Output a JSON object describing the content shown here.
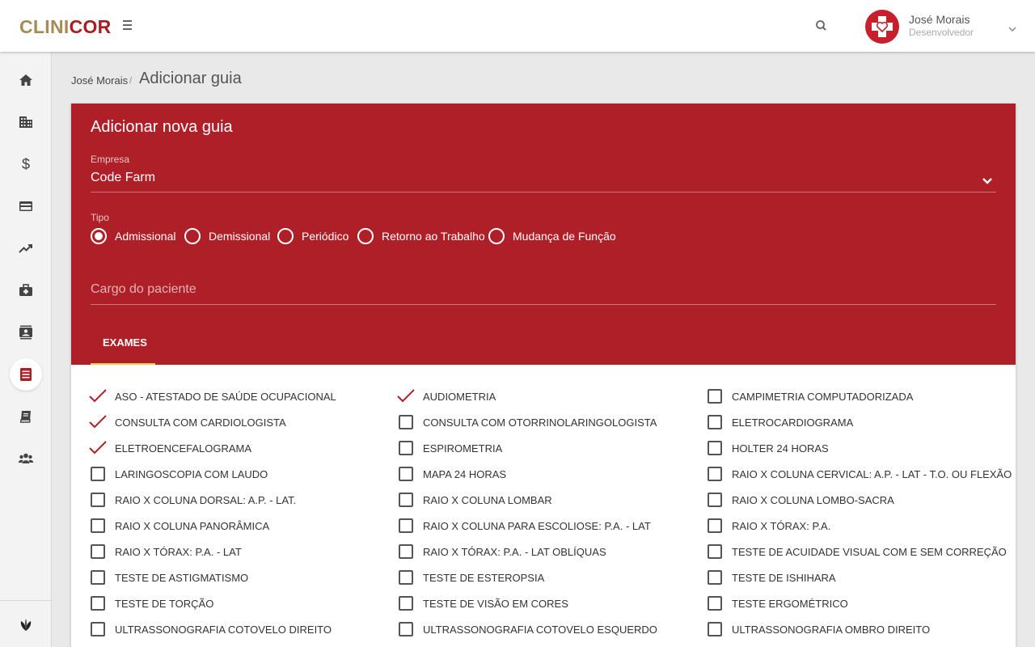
{
  "app": {
    "logo_part1": "CLINI",
    "logo_part2": "COR",
    "brand_red": "#ae1f27",
    "brand_gold": "#a88a57"
  },
  "user": {
    "name": "José Morais",
    "role": "Desenvolvedor"
  },
  "sidebar": {
    "items": [
      {
        "icon": "home-icon"
      },
      {
        "icon": "building-icon"
      },
      {
        "icon": "dollar-icon"
      },
      {
        "icon": "credit-card-icon"
      },
      {
        "icon": "trending-up-icon"
      },
      {
        "icon": "medical-kit-icon"
      },
      {
        "icon": "contacts-icon"
      },
      {
        "icon": "list-icon",
        "active": true
      },
      {
        "icon": "book-icon"
      },
      {
        "icon": "group-icon"
      }
    ],
    "footer_icon": "leaf-icon"
  },
  "breadcrumb": {
    "parent": "José Morais",
    "separator": "/",
    "current": "Adicionar guia"
  },
  "form": {
    "title": "Adicionar nova guia",
    "empresa_label": "Empresa",
    "empresa_value": "Code Farm",
    "tipo_label": "Tipo",
    "tipo_options": [
      "Admissional",
      "Demissional",
      "Periódico",
      "Retorno ao Trabalho",
      "Mudança de Função"
    ],
    "tipo_selected": "Admissional",
    "cargo_placeholder": "Cargo do paciente"
  },
  "tabs": [
    {
      "label": "EXAMES",
      "active": true
    }
  ],
  "exams": [
    {
      "label": "ASO - ATESTADO DE SAÚDE OCUPACIONAL",
      "checked": true
    },
    {
      "label": "AUDIOMETRIA",
      "checked": true
    },
    {
      "label": "CAMPIMETRIA COMPUTADORIZADA",
      "checked": false
    },
    {
      "label": "CONSULTA COM CARDIOLOGISTA",
      "checked": true
    },
    {
      "label": "CONSULTA COM OTORRINOLARINGOLOGISTA",
      "checked": false
    },
    {
      "label": "ELETROCARDIOGRAMA",
      "checked": false
    },
    {
      "label": "ELETROENCEFALOGRAMA",
      "checked": true
    },
    {
      "label": "ESPIROMETRIA",
      "checked": false
    },
    {
      "label": "HOLTER 24 HORAS",
      "checked": false
    },
    {
      "label": "LARINGOSCOPIA COM LAUDO",
      "checked": false
    },
    {
      "label": "MAPA 24 HORAS",
      "checked": false
    },
    {
      "label": "RAIO X COLUNA CERVICAL: A.P. - LAT - T.O. OU FLEXÃO",
      "checked": false
    },
    {
      "label": "RAIO X COLUNA DORSAL: A.P. - LAT.",
      "checked": false
    },
    {
      "label": "RAIO X COLUNA LOMBAR",
      "checked": false
    },
    {
      "label": "RAIO X COLUNA LOMBO-SACRA",
      "checked": false
    },
    {
      "label": "RAIO X COLUNA PANORÂMICA",
      "checked": false
    },
    {
      "label": "RAIO X COLUNA PARA ESCOLIOSE: P.A. - LAT",
      "checked": false
    },
    {
      "label": "RAIO X TÓRAX: P.A.",
      "checked": false
    },
    {
      "label": "RAIO X TÓRAX: P.A. - LAT",
      "checked": false
    },
    {
      "label": "RAIO X TÓRAX: P.A. - LAT OBLÍQUAS",
      "checked": false
    },
    {
      "label": "TESTE DE ACUIDADE VISUAL COM E SEM CORREÇÃO",
      "checked": false
    },
    {
      "label": "TESTE DE ASTIGMATISMO",
      "checked": false
    },
    {
      "label": "TESTE DE ESTEROPSIA",
      "checked": false
    },
    {
      "label": "TESTE DE ISHIHARA",
      "checked": false
    },
    {
      "label": "TESTE DE TORÇÃO",
      "checked": false
    },
    {
      "label": "TESTE DE VISÃO EM CORES",
      "checked": false
    },
    {
      "label": "TESTE ERGOMÉTRICO",
      "checked": false
    },
    {
      "label": "ULTRASSONOGRAFIA COTOVELO DIREITO",
      "checked": false
    },
    {
      "label": "ULTRASSONOGRAFIA COTOVELO ESQUERDO",
      "checked": false
    },
    {
      "label": "ULTRASSONOGRAFIA OMBRO DIREITO",
      "checked": false
    }
  ]
}
